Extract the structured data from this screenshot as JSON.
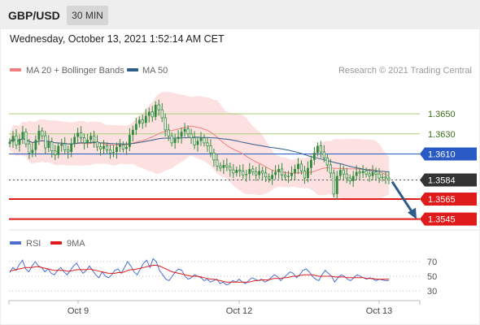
{
  "header": {
    "symbol": "GBP/USD",
    "timeframe": "30 MIN",
    "datetime": "Wednesday, October 13, 2021 1:52:14 AM CET"
  },
  "colors": {
    "ma20": "#f08080",
    "bands_fill": "#fde0e0",
    "ma50": "#2e5c8a",
    "candle": "#2e8b3a",
    "resistance": "#a8cf7a",
    "support": "#e01b1b",
    "pivot": "#2a5bc4",
    "current": "#333333",
    "rsi": "#4a6fd0",
    "rsi_ma": "#e01b1b",
    "arrow": "#2e5c8a"
  },
  "chart_data": [
    {
      "type": "candlestick",
      "legend": [
        {
          "name": "MA 20 + Bollinger Bands",
          "color": "#f08080"
        },
        {
          "name": "MA 50",
          "color": "#2e5c8a"
        }
      ],
      "watermark": "Research © 2021 Trading Central",
      "ylim": [
        1.3535,
        1.3676
      ],
      "x_ticks": [
        "Oct 9",
        "Oct 12",
        "Oct 13"
      ],
      "levels": [
        {
          "value": 1.365,
          "label": "1.3650",
          "kind": "resistance"
        },
        {
          "value": 1.363,
          "label": "1.3630",
          "kind": "resistance"
        },
        {
          "value": 1.361,
          "label": "1.3610",
          "kind": "pivot"
        },
        {
          "value": 1.3584,
          "label": "1.3584",
          "kind": "current"
        },
        {
          "value": 1.3565,
          "label": "1.3565",
          "kind": "support"
        },
        {
          "value": 1.3545,
          "label": "1.3545",
          "kind": "support"
        }
      ],
      "forecast": {
        "from": 1.3584,
        "to": 1.3545,
        "direction": "down"
      },
      "close_series": [
        1.3622,
        1.3628,
        1.3619,
        1.3625,
        1.3632,
        1.362,
        1.3611,
        1.3614,
        1.3624,
        1.3633,
        1.3628,
        1.3616,
        1.3622,
        1.3613,
        1.3609,
        1.3618,
        1.362,
        1.3614,
        1.3612,
        1.362,
        1.3627,
        1.3631,
        1.3626,
        1.3621,
        1.3624,
        1.3628,
        1.3622,
        1.3617,
        1.3615,
        1.3618,
        1.3614,
        1.3611,
        1.3612,
        1.3617,
        1.3619,
        1.3615,
        1.3617,
        1.3629,
        1.3634,
        1.364,
        1.3644,
        1.3641,
        1.3648,
        1.3652,
        1.3647,
        1.3659,
        1.3654,
        1.3646,
        1.3634,
        1.3628,
        1.3621,
        1.3625,
        1.3627,
        1.3632,
        1.3635,
        1.363,
        1.3626,
        1.3619,
        1.3623,
        1.3626,
        1.3621,
        1.3618,
        1.3611,
        1.3604,
        1.3598,
        1.3596,
        1.3599,
        1.3597,
        1.3594,
        1.3591,
        1.3594,
        1.3593,
        1.3589,
        1.359,
        1.3595,
        1.3592,
        1.3589,
        1.3593,
        1.3591,
        1.3587,
        1.3585,
        1.3589,
        1.3592,
        1.3595,
        1.3589,
        1.3587,
        1.3588,
        1.3591,
        1.3595,
        1.36,
        1.3593,
        1.3586,
        1.3596,
        1.3604,
        1.3611,
        1.3618,
        1.3612,
        1.3606,
        1.3599,
        1.3591,
        1.357,
        1.3588,
        1.3594,
        1.359,
        1.3586,
        1.3583,
        1.3588,
        1.3592,
        1.3591,
        1.3593,
        1.359,
        1.3588,
        1.3592,
        1.359,
        1.3586,
        1.3587,
        1.3586,
        1.3584
      ]
    },
    {
      "type": "line",
      "legend": [
        {
          "name": "RSI",
          "color": "#4a6fd0"
        },
        {
          "name": "9MA",
          "color": "#e01b1b"
        }
      ],
      "ylim": [
        20,
        80
      ],
      "y_ticks": [
        70,
        50,
        30
      ],
      "series": [
        {
          "name": "RSI",
          "values": [
            55,
            62,
            58,
            66,
            72,
            60,
            56,
            64,
            70,
            64,
            62,
            56,
            60,
            54,
            52,
            58,
            62,
            56,
            52,
            58,
            64,
            68,
            60,
            54,
            58,
            64,
            58,
            52,
            48,
            56,
            50,
            48,
            52,
            58,
            60,
            54,
            62,
            70,
            64,
            56,
            52,
            60,
            68,
            72,
            62,
            74,
            70,
            58,
            52,
            46,
            44,
            50,
            56,
            60,
            58,
            50,
            46,
            48,
            52,
            50,
            48,
            44,
            46,
            42,
            44,
            46,
            40,
            42,
            38,
            40,
            44,
            42,
            46,
            42,
            40,
            44,
            48,
            46,
            44,
            46,
            42,
            44,
            48,
            52,
            50,
            44,
            48,
            52,
            56,
            54,
            48,
            52,
            58,
            60,
            56,
            50,
            46,
            44,
            52,
            58,
            54,
            50,
            42,
            48,
            52,
            50,
            46,
            44,
            48,
            52,
            50,
            48,
            46,
            48,
            46,
            44,
            46,
            45,
            44,
            44
          ]
        },
        {
          "name": "9MA",
          "values": [
            57,
            58,
            59,
            60,
            61,
            62,
            62,
            62,
            63,
            63,
            62,
            61,
            60,
            59,
            58,
            58,
            58,
            58,
            57,
            57,
            58,
            59,
            59,
            59,
            59,
            60,
            59,
            58,
            57,
            56,
            55,
            54,
            54,
            54,
            55,
            55,
            56,
            58,
            59,
            59,
            60,
            61,
            62,
            63,
            64,
            65,
            65,
            64,
            62,
            60,
            58,
            56,
            55,
            54,
            53,
            52,
            51,
            50,
            50,
            50,
            49,
            48,
            47,
            46,
            46,
            45,
            44,
            43,
            42,
            42,
            42,
            42,
            42,
            42,
            42,
            42,
            43,
            44,
            44,
            45,
            45,
            45,
            46,
            47,
            47,
            47,
            48,
            48,
            49,
            50,
            50,
            51,
            52,
            52,
            52,
            52,
            51,
            50,
            50,
            50,
            50,
            50,
            49,
            49,
            49,
            49,
            48,
            48,
            48,
            48,
            48,
            48,
            47,
            47,
            47,
            46,
            46,
            46,
            46,
            46
          ]
        }
      ]
    }
  ]
}
